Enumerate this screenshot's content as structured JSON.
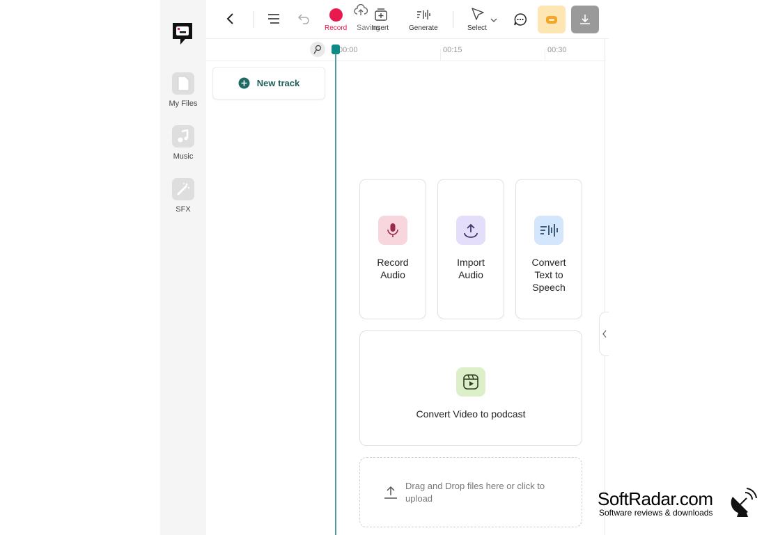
{
  "sidebar": {
    "items": [
      {
        "label": "My Files",
        "icon": "file-icon"
      },
      {
        "label": "Music",
        "icon": "music-note-icon"
      },
      {
        "label": "SFX",
        "icon": "magic-wand-icon"
      }
    ]
  },
  "toolbar": {
    "record_label": "Record",
    "saving_label": "Saving",
    "insert_label": "Insert",
    "generate_label": "Generate",
    "select_label": "Select"
  },
  "timeline": {
    "ticks": [
      "00:00",
      "00:15",
      "00:30"
    ]
  },
  "tracks": {
    "new_track_label": "New track"
  },
  "cards": {
    "record_audio": [
      "Record",
      "Audio"
    ],
    "import_audio": [
      "Import",
      "Audio"
    ],
    "tts": [
      "Convert",
      "Text to",
      "Speech"
    ],
    "video_podcast": "Convert Video to podcast"
  },
  "dropzone": {
    "text": "Drag and Drop files here or click to upload"
  },
  "watermark": {
    "title": "SoftRadar.com",
    "subtitle": "Software reviews & downloads"
  },
  "colors": {
    "record": "#e8194f",
    "accent": "#0f8a84",
    "mic_bg": "#f7d6de",
    "import_bg": "#e4defa",
    "tts_bg": "#d3e6fb",
    "video_bg": "#dcefc8"
  }
}
